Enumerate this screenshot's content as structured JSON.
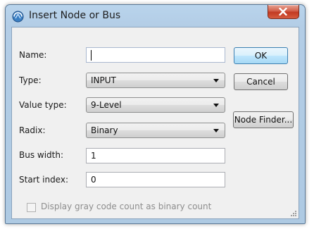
{
  "window": {
    "title": "Insert Node or Bus"
  },
  "form": {
    "name_label": "Name:",
    "name_value": "",
    "type_label": "Type:",
    "type_value": "INPUT",
    "value_type_label": "Value type:",
    "value_type_value": "9-Level",
    "radix_label": "Radix:",
    "radix_value": "Binary",
    "bus_width_label": "Bus width:",
    "bus_width_value": "1",
    "start_index_label": "Start index:",
    "start_index_value": "0",
    "gray_code_label": "Display gray code count as binary count",
    "gray_code_checked": false,
    "gray_code_enabled": false
  },
  "buttons": {
    "ok": "OK",
    "cancel": "Cancel",
    "node_finder": "Node Finder..."
  },
  "colors": {
    "titlebar": "#b9d4ec",
    "close_button": "#c23a22",
    "client_bg": "#f0f0f0",
    "default_button_border": "#3c7fb1"
  }
}
